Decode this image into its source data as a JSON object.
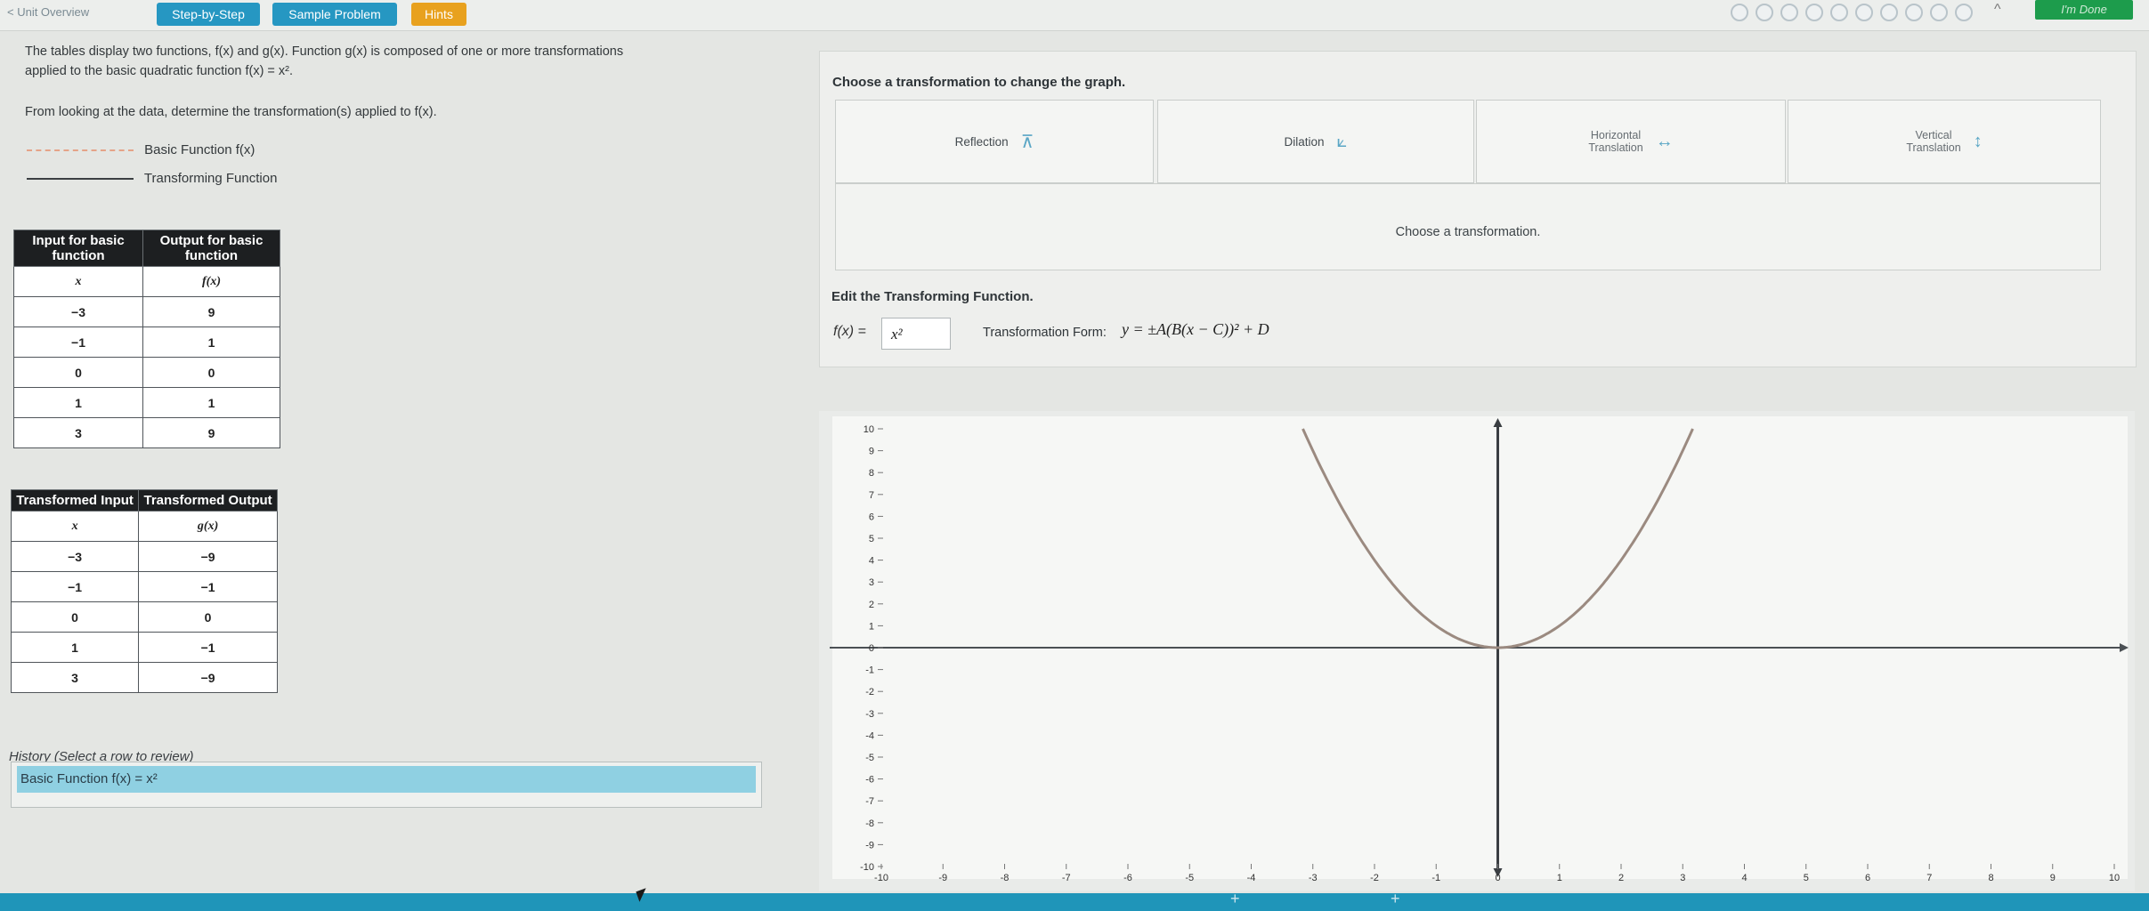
{
  "topbar": {
    "back_label": "< Unit Overview",
    "step_label": "Step-by-Step",
    "sample_label": "Sample Problem",
    "hints_label": "Hints",
    "done_label": "I'm Done",
    "progress_dot_count": 10
  },
  "left": {
    "intro_line1": "The tables display two functions, f(x) and g(x). Function g(x) is composed of one or more transformations",
    "intro_line2": "applied to the basic quadratic function f(x) = x².",
    "intro_line3": "From looking at the data, determine the transformation(s) applied to f(x).",
    "legend_basic": "Basic Function f(x)",
    "legend_transforming": "Transforming Function",
    "table1": {
      "headers": [
        "Input for basic function",
        "Output for basic function"
      ],
      "subheaders": [
        "x",
        "f(x)"
      ],
      "rows": [
        [
          "−3",
          "9"
        ],
        [
          "−1",
          "1"
        ],
        [
          "0",
          "0"
        ],
        [
          "1",
          "1"
        ],
        [
          "3",
          "9"
        ]
      ]
    },
    "table2": {
      "headers": [
        "Transformed Input",
        "Transformed Output"
      ],
      "subheaders": [
        "x",
        "g(x)"
      ],
      "rows": [
        [
          "−3",
          "−9"
        ],
        [
          "−1",
          "−1"
        ],
        [
          "0",
          "0"
        ],
        [
          "1",
          "−1"
        ],
        [
          "3",
          "−9"
        ]
      ]
    },
    "history_title": "History (Select a row to review)",
    "history_row": "Basic Function f(x) = x²"
  },
  "right": {
    "choose_heading": "Choose a transformation to change the graph.",
    "buttons": {
      "reflection": "Reflection",
      "dilation": "Dilation",
      "horizontal_1": "Horizontal",
      "horizontal_2": "Translation",
      "vertical_1": "Vertical",
      "vertical_2": "Translation"
    },
    "choose_msg": "Choose a transformation.",
    "edit_heading": "Edit the Transforming Function.",
    "fx_label": "f(x) =",
    "fx_value": "x²",
    "form_label": "Transformation Form:",
    "form_expr": "y = ±A(B(x − C))² + D"
  },
  "colors": {
    "accent": "#2697c2",
    "hints": "#e8a11e",
    "done": "#1d9c4c",
    "curve": "#9b8a80",
    "history_selected": "#8fd0e2"
  },
  "chart_data": {
    "type": "line",
    "series": [
      {
        "x": [
          -3,
          -2,
          -1,
          0,
          1,
          2,
          3
        ],
        "values": [
          9,
          4,
          1,
          0,
          1,
          4,
          9
        ]
      }
    ],
    "xlim": [
      -10,
      10
    ],
    "ylim": [
      -10,
      10
    ],
    "x_ticks": [
      "-10",
      "-9",
      "-8",
      "-7",
      "-6",
      "-5",
      "-4",
      "-3",
      "-2",
      "-1",
      "0",
      "1",
      "2",
      "3",
      "4",
      "5",
      "6",
      "7",
      "8",
      "9",
      "10"
    ],
    "y_ticks": [
      "-10",
      "-9",
      "-8",
      "-7",
      "-6",
      "-5",
      "-4",
      "-3",
      "-2",
      "-1",
      "0",
      "1",
      "2",
      "3",
      "4",
      "5",
      "6",
      "7",
      "8",
      "9",
      "10"
    ],
    "grid": false
  }
}
